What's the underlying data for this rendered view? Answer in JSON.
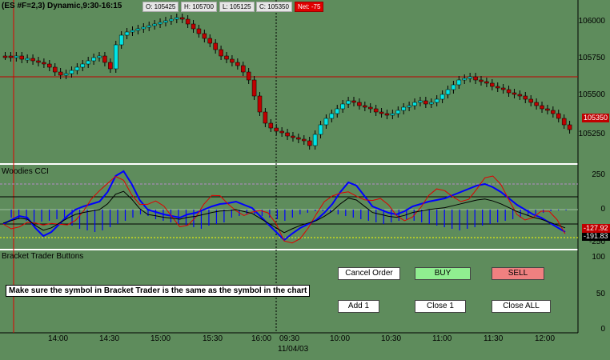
{
  "chart": {
    "title": "(ES #F=2,3) Dynamic,9:30-16:15",
    "ohlc": {
      "open": "O: 105425",
      "high": "H: 105700",
      "low": "L: 105125",
      "close": "C: 105350",
      "net": "Net: -75"
    }
  },
  "price_axis": [
    "106000",
    "105750",
    "105500",
    "105250"
  ],
  "last_price": "105350",
  "cci": {
    "label": "Woodies CCI",
    "axis": [
      "250",
      "0",
      "-250"
    ],
    "last_value": "-127.92",
    "overlap_value": "-191.83"
  },
  "buttons_panel": {
    "label": "Bracket Trader Buttons",
    "axis": [
      "100",
      "50",
      "0"
    ],
    "note": "Make sure the symbol in Bracket Trader is the same as the symbol in the chart",
    "cancel_label": "Cancel Order",
    "buy_label": "BUY",
    "sell_label": "SELL",
    "add_label": "Add 1",
    "close1_label": "Close 1",
    "closeall_label": "Close ALL"
  },
  "time_axis": [
    "14:00",
    "14:30",
    "15:00",
    "15:30",
    "16:00",
    "09:30",
    "10:00",
    "10:30",
    "11:00",
    "11:30",
    "12:00"
  ],
  "date_label": "11/04/03",
  "colors": {
    "background": "#5e8c5c",
    "up_candle": "#00e5e5",
    "down_candle": "#c00000",
    "histogram": "#0000ff",
    "cci_line": "#0000ff",
    "turbo_line": "#e00000",
    "lsma_line": "#000000"
  },
  "chart_data": {
    "type": "line",
    "price_axis_ticks": [
      106000,
      105750,
      105500,
      105250
    ],
    "last_close": 105350,
    "cci_axis_ticks": [
      250,
      0,
      -250
    ]
  }
}
